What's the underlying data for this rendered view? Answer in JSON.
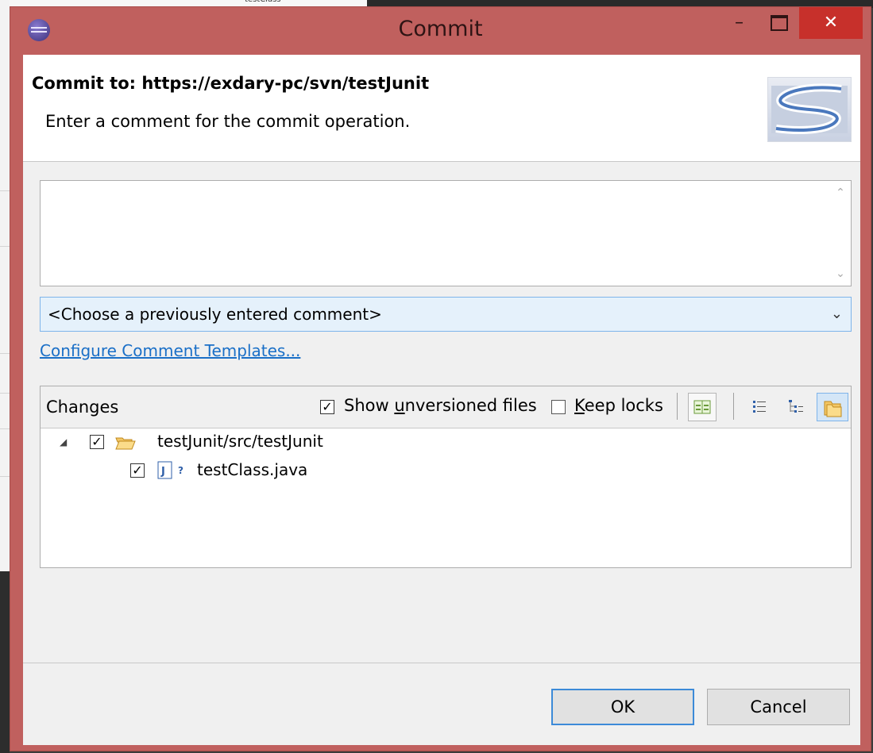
{
  "window": {
    "title": "Commit",
    "minimize_glyph": "–",
    "close_glyph": "✕"
  },
  "background": {
    "partial_tree_label": "testClass"
  },
  "header": {
    "title": "Commit to: https://exdary-pc/svn/testJunit",
    "description": "Enter a comment for the commit operation."
  },
  "comment": {
    "value": "",
    "scroll_up_glyph": "⌃",
    "scroll_down_glyph": "⌄"
  },
  "previous_comments": {
    "selected": "<Choose a previously entered comment>",
    "arrow": "⌄"
  },
  "templates_link": "Configure Comment Templates...",
  "changes": {
    "label": "Changes",
    "show_unversioned": {
      "pre": "Show ",
      "mnemonic": "u",
      "post": "nversioned files",
      "checked": true
    },
    "keep_locks": {
      "mnemonic": "K",
      "post": "eep locks",
      "checked": false
    },
    "tree": [
      {
        "label": "testJunit/src/testJunit",
        "checked": true,
        "icon": "folder-open-icon",
        "expanded": true
      },
      {
        "label": "testClass.java",
        "checked": true,
        "icon": "java-file-unversioned-icon"
      }
    ]
  },
  "buttons": {
    "ok": "OK",
    "cancel": "Cancel"
  },
  "colors": {
    "frame": "#c0605e",
    "close_button": "#c7302b",
    "link": "#1a6fc7",
    "combo_bg": "#e5f1fb"
  }
}
